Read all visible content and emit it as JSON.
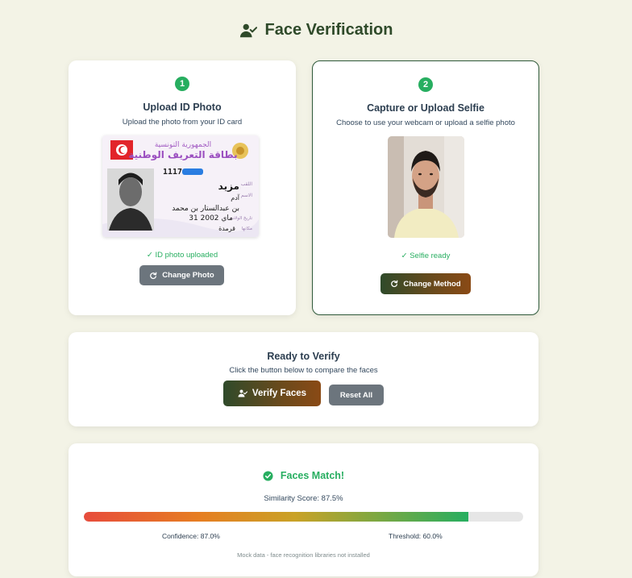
{
  "header": {
    "title": "Face Verification",
    "icon": "user-check-icon"
  },
  "step1": {
    "badge": "1",
    "title": "Upload ID Photo",
    "subtitle": "Upload the photo from your ID card",
    "status": "✓ ID photo uploaded",
    "button_label": "Change Photo",
    "id_card": {
      "header_line1": "الجمهورية التونسية",
      "header_line2": "بطاقة التعريف الوطنية",
      "id_number": "1117",
      "line_surname_label": "اللقب",
      "line_surname": "مزيد",
      "line_name_label": "الاسم",
      "line_name": "آدم",
      "line_father": "بن عبدالستار بن محمد",
      "line_dob_label": "تاريخ الولادة",
      "line_dob": "31 ماي 2002",
      "line_pob_label": "مكانها",
      "line_pob": "قرمدة"
    }
  },
  "step2": {
    "badge": "2",
    "title": "Capture or Upload Selfie",
    "subtitle": "Choose to use your webcam or upload a selfie photo",
    "status": "✓ Selfie ready",
    "button_label": "Change Method"
  },
  "verify": {
    "title": "Ready to Verify",
    "subtitle": "Click the button below to compare the faces",
    "verify_label": "Verify Faces",
    "reset_label": "Reset All"
  },
  "result": {
    "title": "Faces Match!",
    "similarity": "Similarity Score: 87.5%",
    "similarity_percent": 87.5,
    "confidence": "Confidence: 87.0%",
    "threshold": "Threshold: 60.0%",
    "note": "Mock data - face recognition libraries not installed"
  },
  "colors": {
    "accent_green": "#27ae60",
    "title_green": "#2f4a2a",
    "button_gray": "#6c757d",
    "background": "#f3f3e6"
  }
}
